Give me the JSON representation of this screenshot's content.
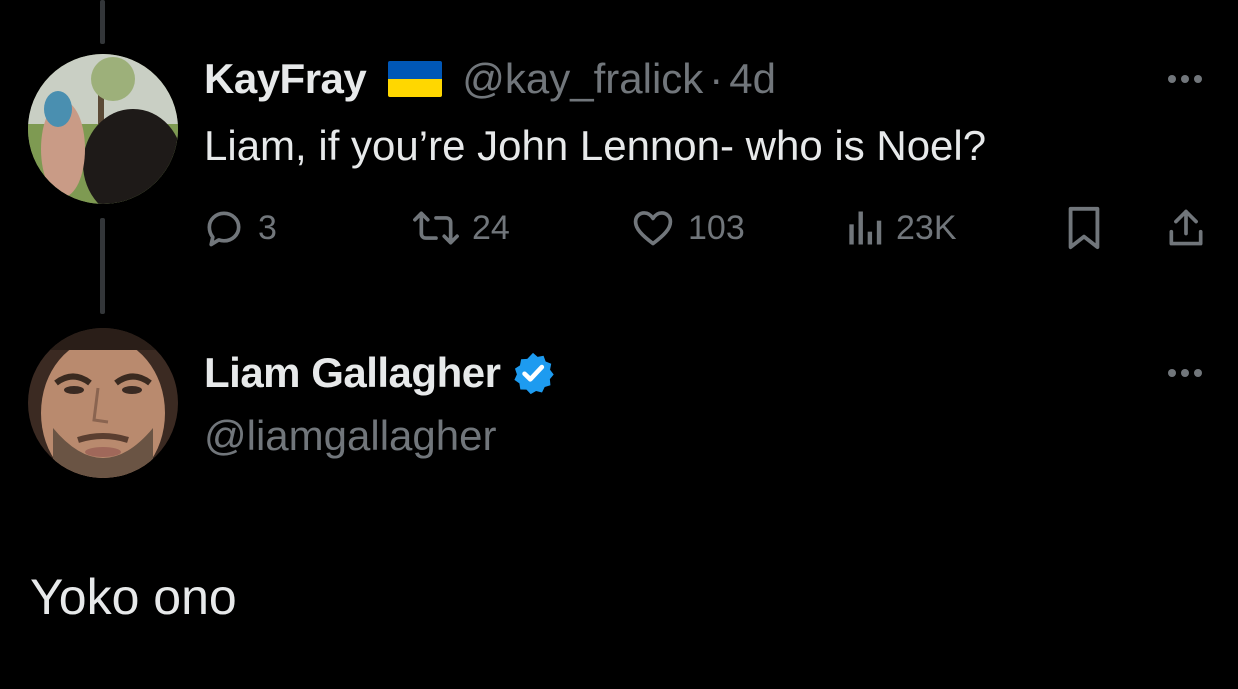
{
  "original_tweet": {
    "display_name": "KayFray",
    "flag_icon": "ukraine-flag-icon",
    "handle": "@kay_fralick",
    "separator": "·",
    "time": "4d",
    "text": "Liam, if you’re John Lennon- who is Noel?",
    "actions": {
      "replies": "3",
      "retweets": "24",
      "likes": "103",
      "views": "23K"
    }
  },
  "reply_tweet": {
    "display_name": "Liam Gallagher",
    "verified_icon": "verified-badge-icon",
    "handle": "@liamgallagher",
    "text": "Yoko ono"
  },
  "colors": {
    "background": "#000000",
    "primary_text": "#e7e9ea",
    "secondary_text": "#71767b",
    "verified_blue": "#1d9bf0",
    "thread_line": "#333639"
  }
}
